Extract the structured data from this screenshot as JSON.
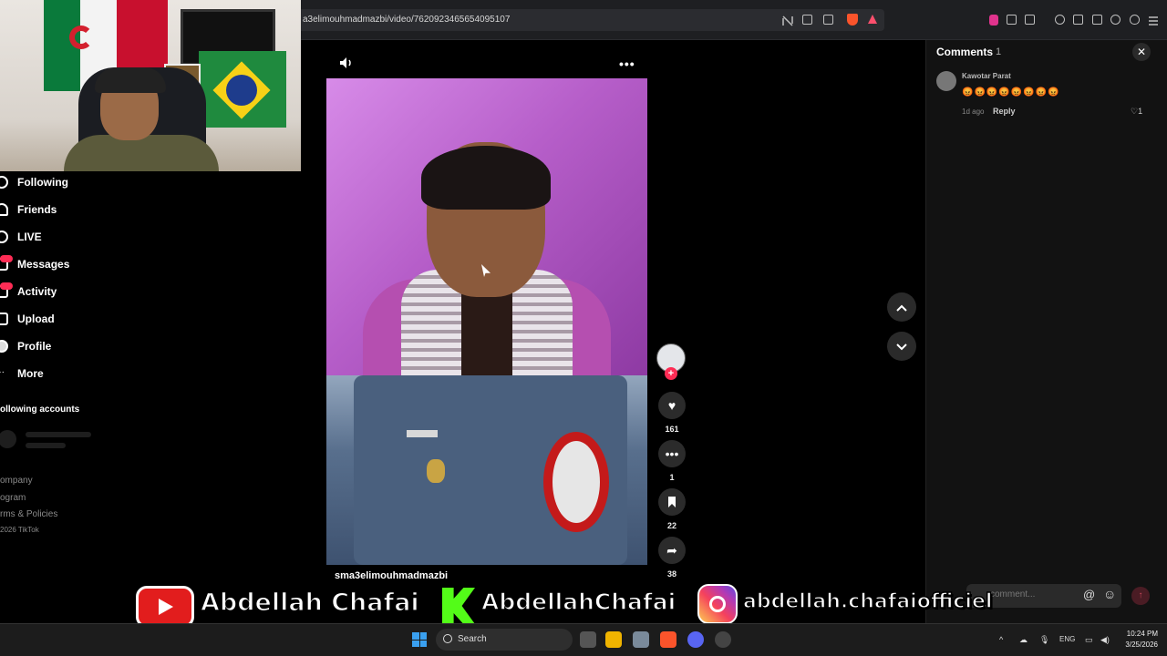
{
  "browser": {
    "url": "a3elimouhmadmazbi/video/7620923465654095107"
  },
  "sidebar": {
    "items": [
      {
        "label": "Following",
        "icon": "following-icon"
      },
      {
        "label": "Friends",
        "icon": "friends-icon"
      },
      {
        "label": "LIVE",
        "icon": "live-icon"
      },
      {
        "label": "Messages",
        "icon": "messages-icon"
      },
      {
        "label": "Activity",
        "icon": "activity-icon"
      },
      {
        "label": "Upload",
        "icon": "upload-icon"
      },
      {
        "label": "Profile",
        "icon": "profile-icon"
      },
      {
        "label": "More",
        "icon": "more-icon"
      }
    ],
    "following_title": "ollowing accounts",
    "footer": [
      "ompany",
      "ogram",
      "rms & Policies",
      "2026 TikTok"
    ]
  },
  "video": {
    "author": "sma3elimouhmadmazbi",
    "likes": "161",
    "comments": "1",
    "saves": "22",
    "shares": "38"
  },
  "comments_panel": {
    "title": "Comments",
    "count": "1",
    "comment": {
      "user": "Kawotar Parat",
      "text": "😡😡😡😡😡😡😡😡",
      "time": "1d ago",
      "reply_label": "Reply",
      "likes": "1"
    },
    "input_placeholder": "comment...",
    "at_symbol": "@"
  },
  "banner": {
    "youtube_name": "Abdellah Chafai",
    "kick_name": "AbdellahChafai",
    "instagram_name": "abdellah.chafaiofficiel"
  },
  "taskbar": {
    "search_label": "Search",
    "language": "ENG",
    "time": "10:24 PM",
    "date": "3/25/2026"
  },
  "colors": {
    "accent": "#fe2c55",
    "panel_bg": "#121212",
    "kick_green": "#53fc18",
    "youtube_red": "#e21d1d"
  }
}
